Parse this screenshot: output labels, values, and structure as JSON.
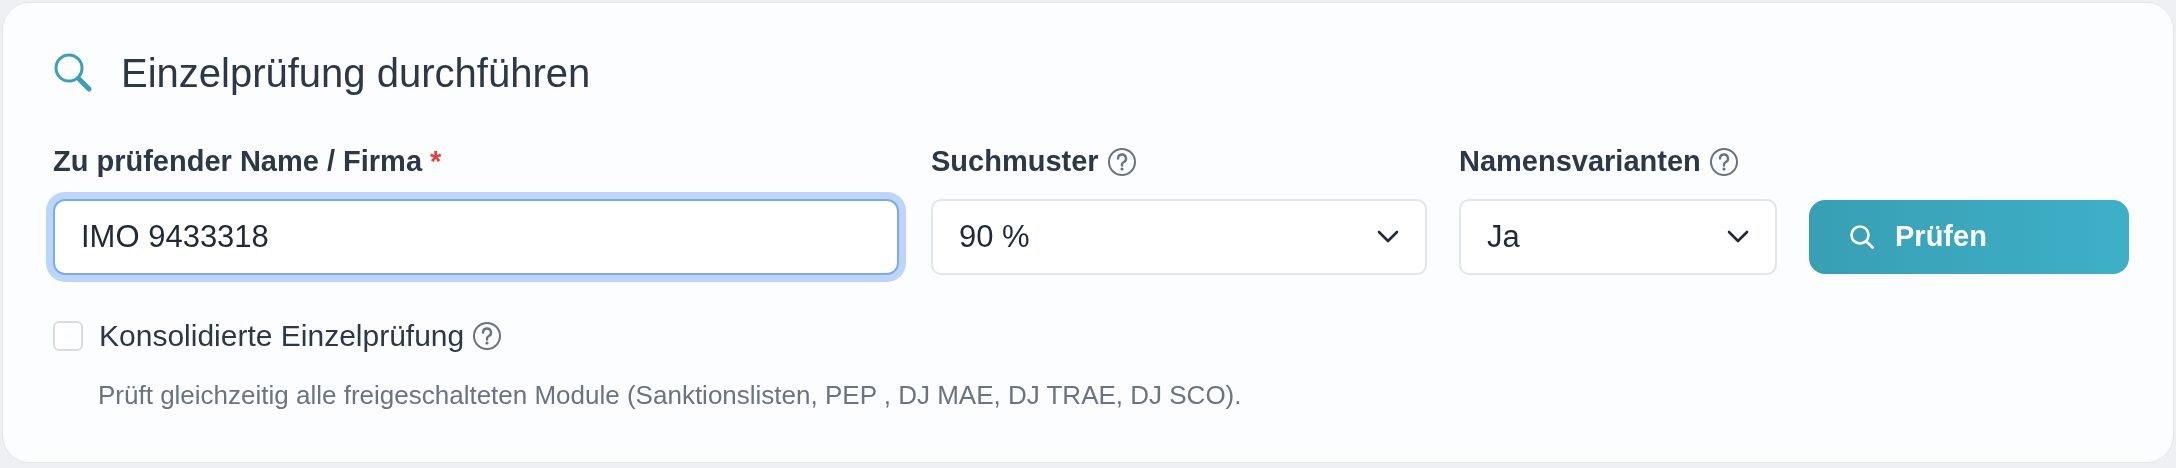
{
  "title": "Einzelprüfung durchführen",
  "fields": [
    {
      "kind": "text",
      "label": "Zu prüfender Name / Firma",
      "required_mark": "*",
      "help": false,
      "value": "IMO 9433318"
    },
    {
      "kind": "select",
      "label": "Suchmuster",
      "help": true,
      "value": "90 %"
    },
    {
      "kind": "select",
      "label": "Namensvarianten",
      "help": true,
      "value": "Ja"
    }
  ],
  "submit_button": "Prüfen",
  "option": {
    "label": "Konsolidierte Einzelprüfung",
    "checked": false,
    "help": true,
    "description": "Prüft gleichzeitig alle freigeschalteten Module (Sanktionslisten, PEP , DJ MAE, DJ TRAE, DJ SCO)."
  }
}
